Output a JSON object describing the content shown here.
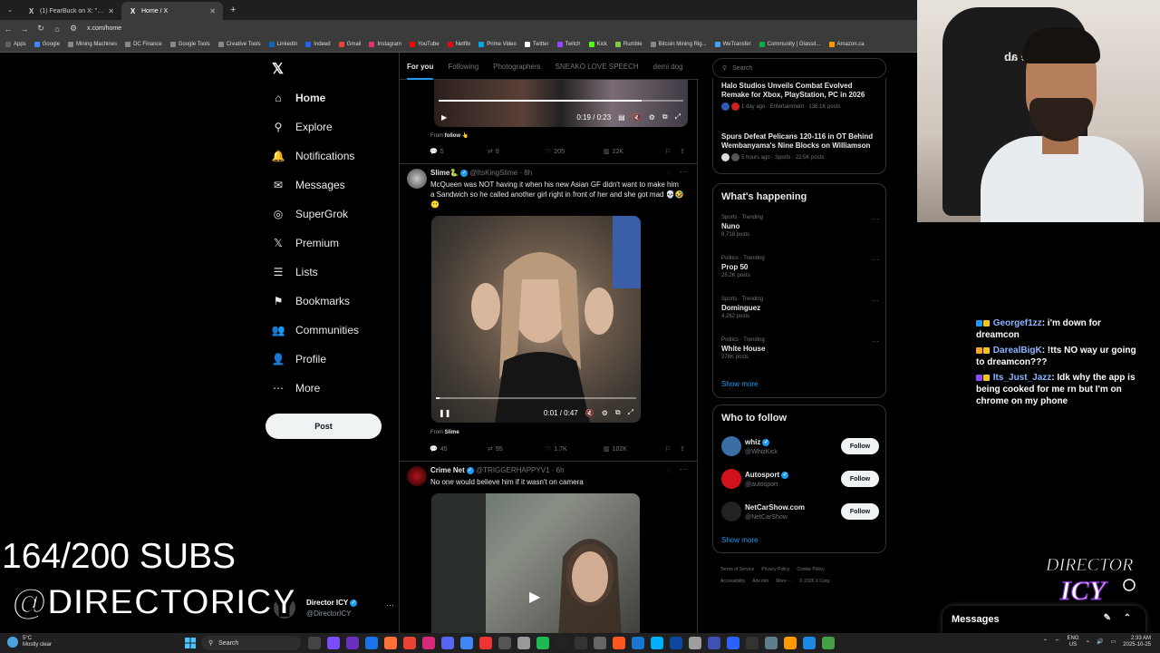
{
  "browser": {
    "tabs": [
      {
        "title": "(1) FearBuck on X: \"Nina Lin and",
        "active": false
      },
      {
        "title": "Home / X",
        "active": true
      }
    ],
    "url": "x.com/home",
    "bookmarks": [
      {
        "label": "Apps",
        "color": "#5f6368"
      },
      {
        "label": "Google",
        "color": "#4285f4"
      },
      {
        "label": "Mining Machines",
        "color": "#888888"
      },
      {
        "label": "DC Finance",
        "color": "#888888"
      },
      {
        "label": "Google Tools",
        "color": "#888888"
      },
      {
        "label": "Creative Tools",
        "color": "#888888"
      },
      {
        "label": "LinkedIn",
        "color": "#0a66c2"
      },
      {
        "label": "Indeed",
        "color": "#2164f3"
      },
      {
        "label": "Gmail",
        "color": "#ea4335"
      },
      {
        "label": "Instagram",
        "color": "#e1306c"
      },
      {
        "label": "YouTube",
        "color": "#ff0000"
      },
      {
        "label": "Netflix",
        "color": "#e50914"
      },
      {
        "label": "Prime Video",
        "color": "#00a8e1"
      },
      {
        "label": "Twitter",
        "color": "#ffffff"
      },
      {
        "label": "Twitch",
        "color": "#9146ff"
      },
      {
        "label": "Kick",
        "color": "#53fc18"
      },
      {
        "label": "Rumble",
        "color": "#85c742"
      },
      {
        "label": "Bitcoin Mining Rig...",
        "color": "#888888"
      },
      {
        "label": "WeTransfer",
        "color": "#409fff"
      },
      {
        "label": "Community | Glassd...",
        "color": "#0caa41"
      },
      {
        "label": "Amazon.ca",
        "color": "#ff9900"
      }
    ]
  },
  "nav": {
    "items": [
      {
        "label": "Home",
        "icon": "home-icon",
        "glyph": "⌂"
      },
      {
        "label": "Explore",
        "icon": "search-icon",
        "glyph": "⚲"
      },
      {
        "label": "Notifications",
        "icon": "bell-icon",
        "glyph": "🔔"
      },
      {
        "label": "Messages",
        "icon": "envelope-icon",
        "glyph": "✉"
      },
      {
        "label": "SuperGrok",
        "icon": "grok-icon",
        "glyph": "◎"
      },
      {
        "label": "Premium",
        "icon": "x-logo-icon",
        "glyph": "𝕏"
      },
      {
        "label": "Lists",
        "icon": "list-icon",
        "glyph": "☰"
      },
      {
        "label": "Bookmarks",
        "icon": "bookmark-icon",
        "glyph": "⚑"
      },
      {
        "label": "Communities",
        "icon": "people-icon",
        "glyph": "👥"
      },
      {
        "label": "Profile",
        "icon": "person-icon",
        "glyph": "👤"
      },
      {
        "label": "More",
        "icon": "more-circle-icon",
        "glyph": "⋯"
      }
    ],
    "post_label": "Post",
    "account": {
      "name": "Director ICY",
      "handle": "@DirectorICY"
    }
  },
  "feed": {
    "tabs": [
      "For you",
      "Following",
      "Photographers",
      "SNEAKO LOVE SPEECH",
      "demi dog"
    ],
    "tweets": [
      {
        "video_time": "0:19 / 0:23",
        "video_progress": 0.83,
        "from_label": "From",
        "from_name": "follow 👆",
        "replies": "5",
        "reposts": "9",
        "likes": "205",
        "views": "22K"
      },
      {
        "name": "Slime🐍",
        "handle": "@ItsKingSlime · 8h",
        "text": "McQueen was NOT having it when his new Asian GF didn't want to make him a Sandwich so he called another girl right in front of her and she got mad 💀🤣😶",
        "video_time": "0:01 / 0:47",
        "video_progress": 0.02,
        "from_label": "From",
        "from_name": "Slime",
        "replies": "45",
        "reposts": "95",
        "likes": "1.7K",
        "views": "102K"
      },
      {
        "name": "Crime Net",
        "handle": "@TRIGGERHAPPYV1 · 6h",
        "text": "No one would believe him if it wasn't on camera"
      }
    ]
  },
  "right": {
    "search_placeholder": "Search",
    "news": [
      {
        "title": "Halo Studios Unveils Combat Evolved Remake for Xbox, PlayStation, PC in 2026",
        "meta": "1 day ago · Entertainment · 136.1K posts"
      },
      {
        "title": "Spurs Defeat Pelicans 120-116 in OT Behind Wembanyama's Nine Blocks on Williamson",
        "meta": "5 hours ago · Sports · 22.5K posts"
      }
    ],
    "happening_title": "What's happening",
    "trends": [
      {
        "context": "Sports · Trending",
        "name": "Nuno",
        "posts": "9,718 posts"
      },
      {
        "context": "Politics · Trending",
        "name": "Prop 50",
        "posts": "28.2K posts"
      },
      {
        "context": "Sports · Trending",
        "name": "Dominguez",
        "posts": "4,262 posts"
      },
      {
        "context": "Politics · Trending",
        "name": "White House",
        "posts": "378K posts"
      }
    ],
    "show_more": "Show more",
    "who_title": "Who to follow",
    "who": [
      {
        "name": "whiz",
        "handle": "@WhizKick",
        "follow": "Follow",
        "color": "#3a6ea5"
      },
      {
        "name": "Autosport",
        "handle": "@autosport",
        "follow": "Follow",
        "color": "#d1121b"
      },
      {
        "name": "NetCarShow.com",
        "handle": "@NetCarShow",
        "follow": "Follow",
        "color": "#222222"
      }
    ],
    "footer": [
      "Terms of Service",
      "Privacy Policy",
      "Cookie Policy",
      "Accessibility",
      "Ads info",
      "More ···",
      "© 2025 X Corp."
    ]
  },
  "messages_drawer": {
    "title": "Messages"
  },
  "stream": {
    "chair_text": "Tese ab",
    "chat": [
      {
        "user": "Georgef1zz",
        "text": ": i'm down for dreamcon"
      },
      {
        "user": "DarealBigK",
        "text": ": !tts NO way ur going to dreamcon???"
      },
      {
        "user": "Its_Just_Jazz",
        "text": ": Idk why the app is being cooked for me rn but I'm on chrome on my phone"
      }
    ],
    "subs": "164/200 SUBS",
    "handle": "@DIRECTORICY",
    "logo_top": "DIRECTOR",
    "logo_bottom": "ICY"
  },
  "taskbar": {
    "temp": "5°C",
    "weather": "Mostly clear",
    "search": "Search",
    "lang": "ENG",
    "region": "US",
    "time": "2:33 AM",
    "date": "2025-10-25"
  }
}
